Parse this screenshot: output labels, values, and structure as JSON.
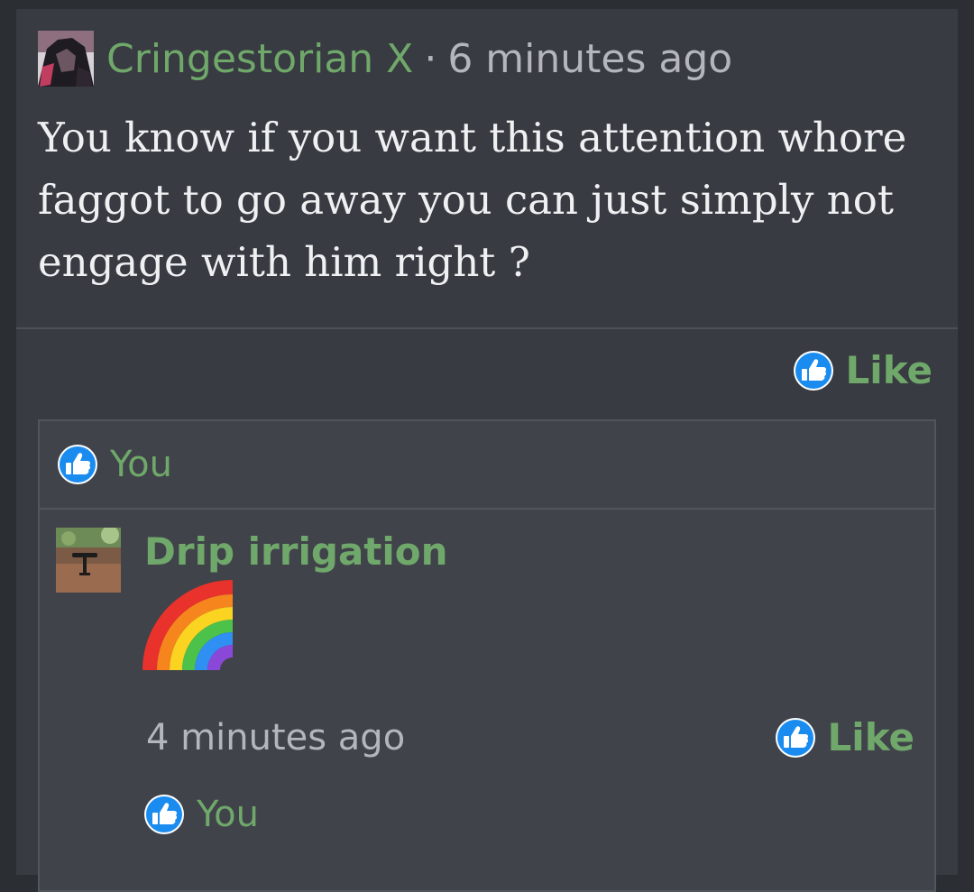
{
  "post": {
    "author": "Cringestorian X",
    "separator": "·",
    "time": "6 minutes ago",
    "body": "You know if you want this attention whore faggot to go away you can just simply not engage with him right ?",
    "like_label": "Like"
  },
  "likes": {
    "summary_label": "You"
  },
  "reply": {
    "author": "Drip irrigation",
    "emoji_icon": "rainbow-icon",
    "time": "4 minutes ago",
    "like_label": "Like",
    "likes_label": "You"
  },
  "colors": {
    "accent_green": "#6fa86a",
    "like_blue": "#1a8cf0",
    "background": "#2b2e33",
    "panel": "#383b41"
  }
}
